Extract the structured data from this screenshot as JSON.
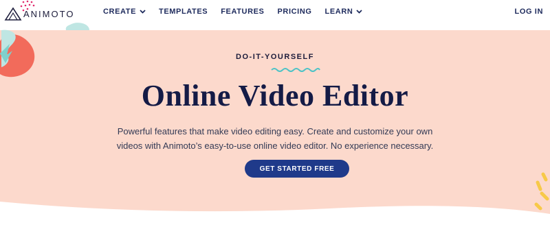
{
  "brand": {
    "name": "ANIMOTO"
  },
  "nav": {
    "items": [
      {
        "label": "CREATE",
        "has_dropdown": true
      },
      {
        "label": "TEMPLATES",
        "has_dropdown": false
      },
      {
        "label": "FEATURES",
        "has_dropdown": false
      },
      {
        "label": "PRICING",
        "has_dropdown": false
      },
      {
        "label": "LEARN",
        "has_dropdown": true
      }
    ],
    "login_label": "LOG IN"
  },
  "hero": {
    "eyebrow": "DO-IT-YOURSELF",
    "title": "Online Video Editor",
    "description": "Powerful features that make video editing easy. Create and customize your own videos with Animoto’s easy-to-use online video editor. No experience necessary.",
    "cta_label": "GET STARTED FREE"
  },
  "colors": {
    "hero_background": "#fcd9cc",
    "navy": "#141b46",
    "cta": "#1f3a8a",
    "squiggle": "#4fc3c6",
    "coral": "#f26b5b",
    "mint": "#bfe6e3",
    "yellow": "#f7c948",
    "magenta": "#e0296c"
  },
  "icons": [
    "animoto-logo-icon",
    "chevron-down-icon",
    "wave-squiggle-icon"
  ]
}
